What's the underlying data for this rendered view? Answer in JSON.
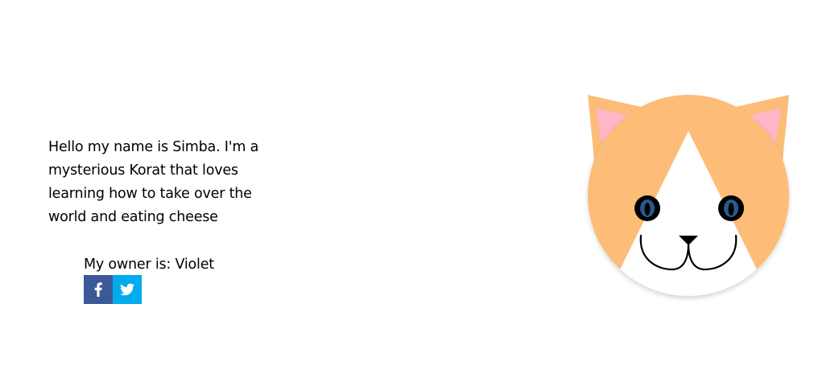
{
  "bio": {
    "text": "Hello my name is Simba. I'm a mysterious Korat that loves learning how to take over the world and eating cheese"
  },
  "owner": {
    "text": "My owner is: Violet"
  },
  "social": {
    "facebook": {
      "icon": "facebook-icon",
      "color": "#3b5998"
    },
    "twitter": {
      "icon": "twitter-icon",
      "color": "#00aced"
    }
  },
  "cat": {
    "fur_color": "#fdbc77",
    "face_color": "#ffffff",
    "ear_inner_color": "#ffb6c8",
    "eye_iris_color": "#2a5a8c"
  }
}
